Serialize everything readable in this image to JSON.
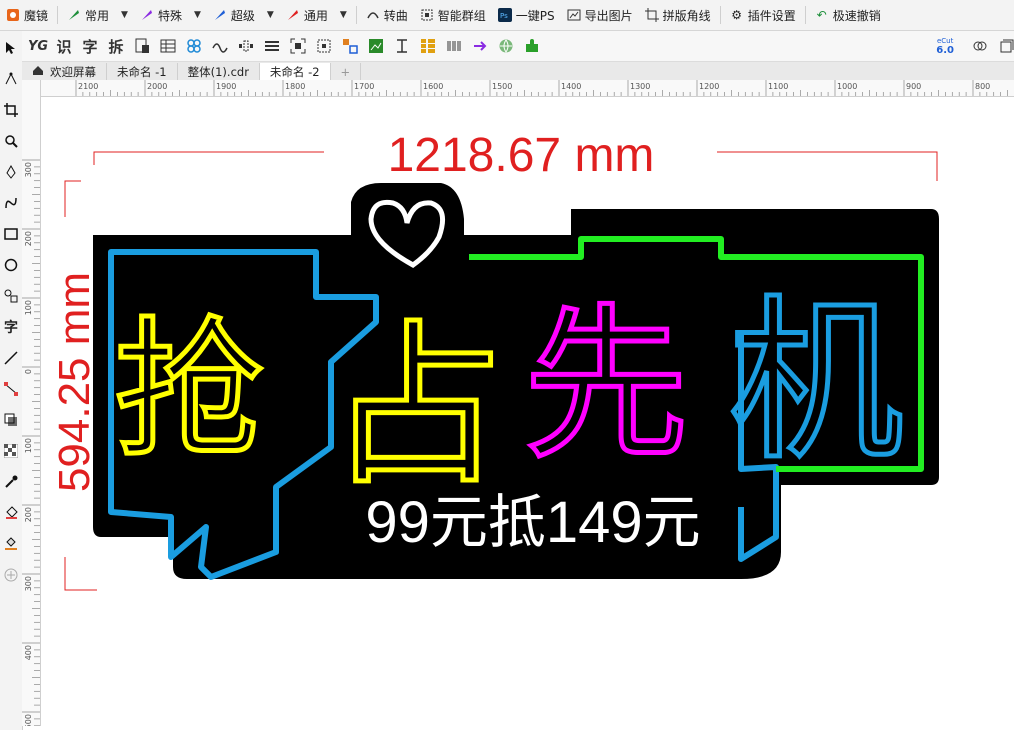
{
  "menubar": {
    "items": [
      {
        "label": "魔镜",
        "icon": "magic-mirror-icon",
        "color": "#e8651a"
      },
      {
        "label": "常用",
        "icon": "pen-icon",
        "color": "#1d8f3a"
      },
      {
        "label": "特殊",
        "icon": "pen-icon",
        "color": "#8a2be2"
      },
      {
        "label": "超级",
        "icon": "pen-icon",
        "color": "#1f5fd6"
      },
      {
        "label": "通用",
        "icon": "pen-icon",
        "color": "#e02020"
      },
      {
        "label": "转曲",
        "icon": "convert-curve-icon"
      },
      {
        "label": "智能群组",
        "icon": "smart-group-icon"
      },
      {
        "label": "一键PS",
        "icon": "photoshop-icon"
      },
      {
        "label": "导出图片",
        "icon": "export-image-icon"
      },
      {
        "label": "拼版角线",
        "icon": "crop-marks-icon"
      },
      {
        "label": "插件设置",
        "icon": "gear-icon"
      },
      {
        "label": "极速撤销",
        "icon": "undo-icon"
      }
    ]
  },
  "toolbar": {
    "text_tools": [
      "识",
      "字",
      "拆"
    ],
    "ecut_badge_top": "eCut",
    "ecut_badge_bottom": "6.0"
  },
  "tabs": [
    {
      "label": "欢迎屏幕",
      "icon": "home-icon",
      "active": false
    },
    {
      "label": "未命名 -1",
      "active": false
    },
    {
      "label": "整体(1).cdr",
      "active": false
    },
    {
      "label": "未命名 -2",
      "active": true
    }
  ],
  "ruler": {
    "h_labels": [
      "2100",
      "2000",
      "1900",
      "1800",
      "1700",
      "1600",
      "1500",
      "1400",
      "1300",
      "1200",
      "1100",
      "1000",
      "900",
      "800"
    ],
    "v_labels": [
      "300",
      "200",
      "100",
      "0",
      "100",
      "200",
      "300",
      "400",
      "500"
    ]
  },
  "toolbox": {
    "text_tool": "字"
  },
  "artwork": {
    "width_dim": "1218.67 mm",
    "height_dim": "594.25 mm",
    "title_chars": [
      {
        "char": "抢",
        "color": "#ffff00"
      },
      {
        "char": "占",
        "color": "#ffff00"
      },
      {
        "char": "先",
        "color": "#ff00ff"
      },
      {
        "char": "机",
        "color": "#1a9de0"
      }
    ],
    "subtitle": "99元抵149元",
    "colors": {
      "dimension": "#e02020",
      "yellow": "#ffff00",
      "magenta": "#ff00ff",
      "blue": "#1a9de0",
      "green": "#22ee22"
    }
  }
}
